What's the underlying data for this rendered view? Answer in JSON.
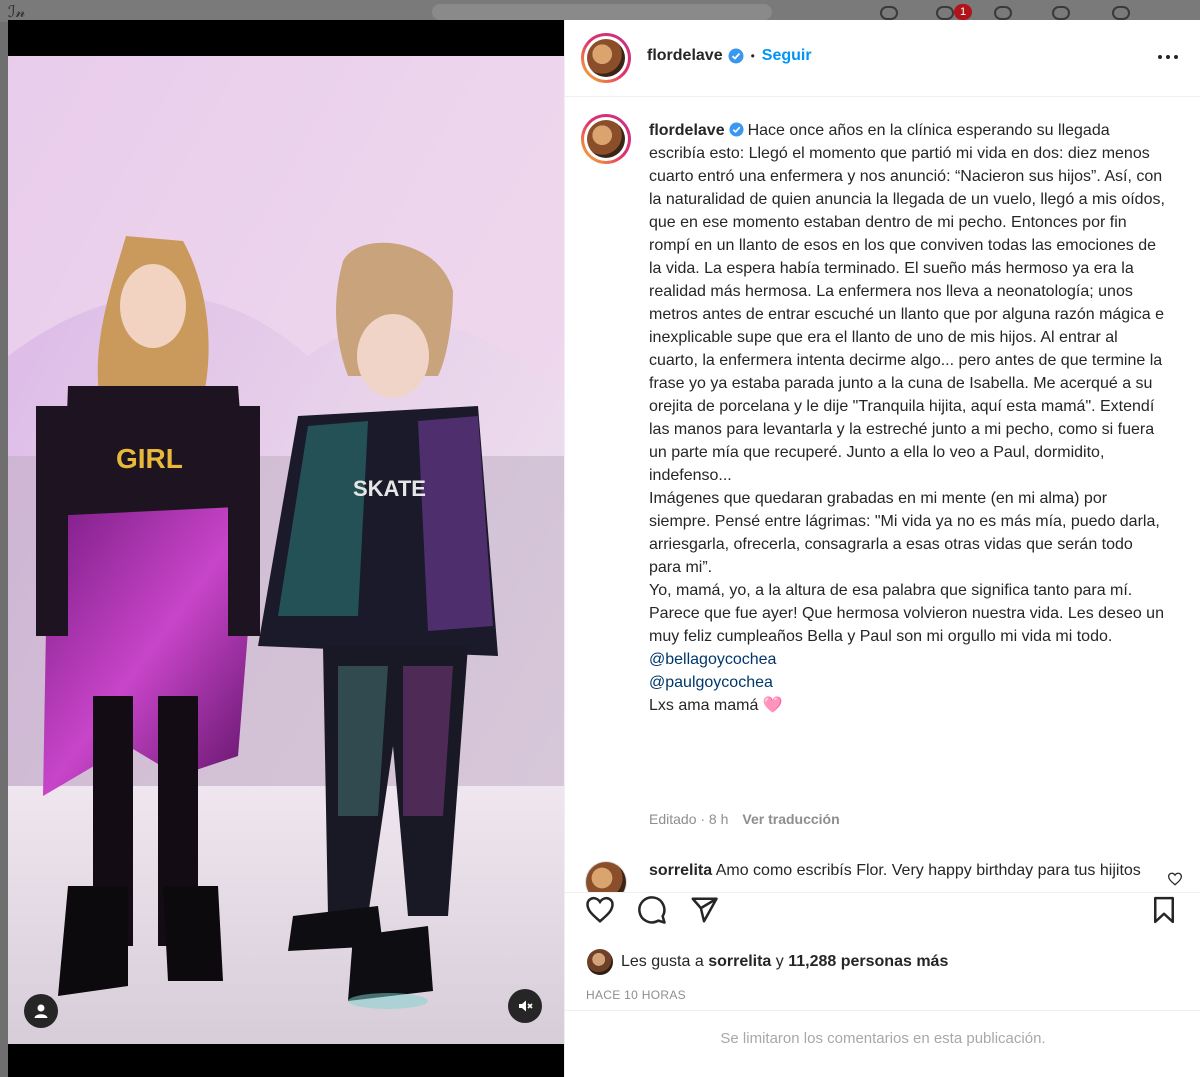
{
  "window": {
    "notification_count": "1"
  },
  "post": {
    "username": "flordelave",
    "follow_label": "Seguir",
    "separator": "•",
    "caption": "Hace once años en la clínica esperando su llegada escribía esto: Llegó el momento que partió mi vida en dos: diez menos cuarto entró una enfermera y nos anunció: “Nacieron sus hijos”. Así, con la naturalidad de quien anuncia la llegada de un vuelo, llegó a mis oídos, que en ese momento estaban dentro de mi pecho. Entonces por fin rompí en un llanto de esos en los que conviven todas las emociones de la vida. La espera había terminado. El sueño más hermoso ya era la realidad más hermosa. La enfermera nos lleva a neonatología; unos metros antes de entrar escuché un llanto que por alguna razón mágica e inexplicable supe que era el llanto de uno de mis hijos. Al entrar al cuarto, la enfermera intenta decirme algo... pero antes de que termine la frase yo ya estaba parada junto a la cuna de Isabella. Me acerqué a su orejita de porcelana y le dije \"Tranquila hijita, aquí esta mamá\". Extendí las manos para levantarla y la estreché junto a mi pecho, como si fuera un parte mía que recuperé. Junto a ella lo veo a Paul, dormidito, indefenso...\nImágenes que quedaran grabadas en mi mente (en mi alma) por siempre. Pensé entre lágrimas: \"Mi vida ya no es más mía, puedo darla, arriesgarla, ofrecerla, consagrarla a esas otras vidas que serán todo para mi”.\nYo, mamá, yo, a la altura de esa palabra que significa tanto para mí.\nParece que fue ayer! Que hermosa volvieron nuestra vida. Les deseo un muy feliz cumpleaños Bella y Paul son mi orgullo mi vida mi todo.",
    "mentions": [
      "@bellagoycochea",
      "@paulgoycochea"
    ],
    "signoff": "Lxs ama mamá 🩷",
    "edited": "Editado · 8 h",
    "translate_label": "Ver traducción",
    "top_comment": {
      "username": "sorrelita",
      "text": "Amo como escribís Flor. Very happy birthday para tus hijitos"
    },
    "likes_prefix": "Les gusta a",
    "likes_user": "sorrelita",
    "likes_and": "y",
    "likes_count": "11,288 personas más",
    "timestamp": "HACE 10 HORAS",
    "comments_limited": "Se limitaron los comentarios en esta publicación."
  },
  "colors": {
    "accent": "#0095f6",
    "verified": "#3897f0",
    "mention": "#00376b",
    "muted": "#8e8e8e"
  },
  "icons": [
    "like-icon",
    "comment-icon",
    "share-icon",
    "save-icon",
    "more-icon",
    "verified-icon",
    "user-tag-icon",
    "mute-icon",
    "heart-small-icon"
  ]
}
